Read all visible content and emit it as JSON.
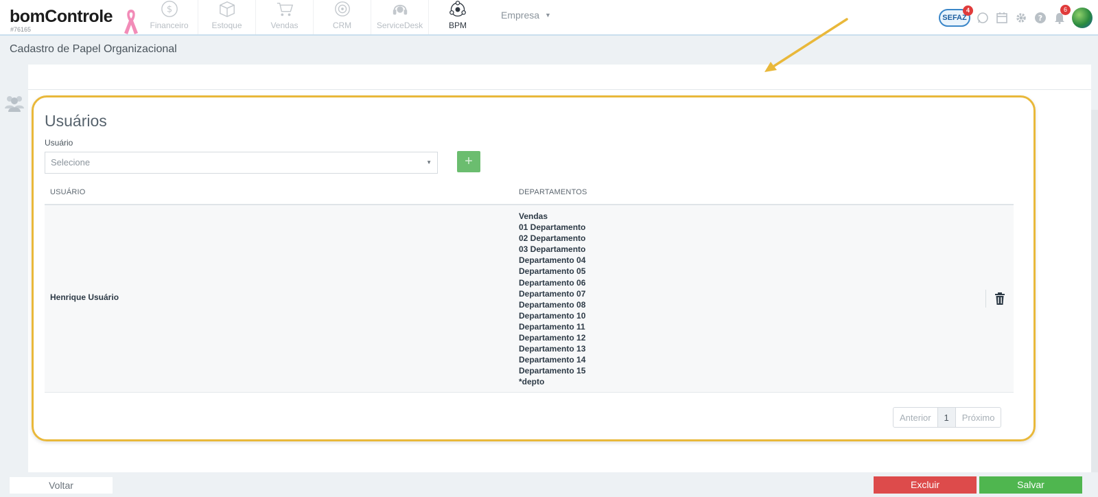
{
  "app": {
    "logo": "bomControle",
    "account_id": "#76165"
  },
  "nav": {
    "modules": [
      {
        "label": "Financeiro",
        "icon": "dollar-circle-icon"
      },
      {
        "label": "Estoque",
        "icon": "box-icon"
      },
      {
        "label": "Vendas",
        "icon": "cart-icon"
      },
      {
        "label": "CRM",
        "icon": "target-icon"
      },
      {
        "label": "ServiceDesk",
        "icon": "headset-icon"
      },
      {
        "label": "BPM",
        "icon": "bpm-icon"
      }
    ],
    "active_module": "BPM",
    "company_menu": "Empresa",
    "sefaz_label": "SEFAZ",
    "sefaz_badge": "4",
    "notifications_badge": "6"
  },
  "page": {
    "title": "Cadastro de Papel Organizacional"
  },
  "users_section": {
    "title": "Usuários",
    "field_label": "Usuário",
    "select_placeholder": "Selecione",
    "add_label": "+",
    "columns": {
      "user": "USUÁRIO",
      "departments": "DEPARTAMENTOS"
    },
    "rows": [
      {
        "user": "Henrique Usuário",
        "departments": [
          "Vendas",
          "01 Departamento",
          "02 Departamento",
          "03 Departamento",
          "Departamento 04",
          "Departamento 05",
          "Departamento 06",
          "Departamento 07",
          "Departamento 08",
          "Departamento 10",
          "Departamento 11",
          "Departamento 12",
          "Departamento 13",
          "Departamento 14",
          "Departamento 15",
          "*depto"
        ]
      }
    ],
    "pagination": {
      "previous": "Anterior",
      "current": "1",
      "next": "Próximo"
    }
  },
  "footer": {
    "back": "Voltar",
    "delete": "Excluir",
    "save": "Salvar"
  },
  "colors": {
    "accent_green": "#4fb64f",
    "danger_red": "#dd4b4b",
    "highlight_yellow": "#e9b83a",
    "badge_red": "#e03b3b"
  }
}
